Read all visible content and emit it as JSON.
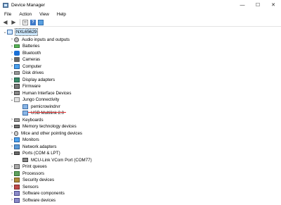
{
  "window": {
    "title": "Device Manager"
  },
  "window_controls": {
    "minimize": "—",
    "maximize": "☐",
    "close": "✕"
  },
  "menu": [
    "File",
    "Action",
    "View",
    "Help"
  ],
  "toolbar": {
    "back": "◀",
    "forward": "▶",
    "help": "?"
  },
  "tree": {
    "root": {
      "label": "NXL65629",
      "chevron": "⌄"
    },
    "items": [
      {
        "label": "Audio inputs and outputs",
        "chevron": "›",
        "icon": "speaker-icon"
      },
      {
        "label": "Batteries",
        "chevron": "›",
        "icon": "battery-icon"
      },
      {
        "label": "Bluetooth",
        "chevron": "›",
        "icon": "bluetooth-icon"
      },
      {
        "label": "Cameras",
        "chevron": "›",
        "icon": "camera-icon"
      },
      {
        "label": "Computer",
        "chevron": "›",
        "icon": "computer-icon"
      },
      {
        "label": "Disk drives",
        "chevron": "›",
        "icon": "disk-drive-icon"
      },
      {
        "label": "Display adapters",
        "chevron": "›",
        "icon": "display-adapter-icon"
      },
      {
        "label": "Firmware",
        "chevron": "›",
        "icon": "firmware-icon"
      },
      {
        "label": "Human Interface Devices",
        "chevron": "›",
        "icon": "hid-icon"
      },
      {
        "label": "Jungo Connectivity",
        "chevron": "⌄",
        "icon": "usb-controller-icon"
      },
      {
        "label": "pemicrowindrvr",
        "chevron": "",
        "icon": "usb-device-icon",
        "child": true
      },
      {
        "label": "USB Multilink 2.0",
        "chevron": "",
        "icon": "usb-device-icon",
        "child": true
      },
      {
        "label": "Keyboards",
        "chevron": "›",
        "icon": "keyboard-icon"
      },
      {
        "label": "Memory technology devices",
        "chevron": "›",
        "icon": "memory-icon"
      },
      {
        "label": "Mice and other pointing devices",
        "chevron": "›",
        "icon": "mouse-icon"
      },
      {
        "label": "Monitors",
        "chevron": "›",
        "icon": "monitor-icon"
      },
      {
        "label": "Network adapters",
        "chevron": "›",
        "icon": "network-adapter-icon"
      },
      {
        "label": "Ports (COM & LPT)",
        "chevron": "⌄",
        "icon": "ports-icon"
      },
      {
        "label": "MCU-Link VCom Port (COM77)",
        "chevron": "",
        "icon": "com-port-icon",
        "child": true
      },
      {
        "label": "Print queues",
        "chevron": "›",
        "icon": "printer-icon"
      },
      {
        "label": "Processors",
        "chevron": "›",
        "icon": "processor-icon"
      },
      {
        "label": "Security devices",
        "chevron": "›",
        "icon": "security-icon"
      },
      {
        "label": "Sensors",
        "chevron": "›",
        "icon": "sensor-icon"
      },
      {
        "label": "Software components",
        "chevron": "›",
        "icon": "software-component-icon"
      },
      {
        "label": "Software devices",
        "chevron": "›",
        "icon": "software-device-icon"
      }
    ]
  },
  "colors": {
    "selection": "#cce8ff",
    "annotation_underline": "#e03030"
  }
}
